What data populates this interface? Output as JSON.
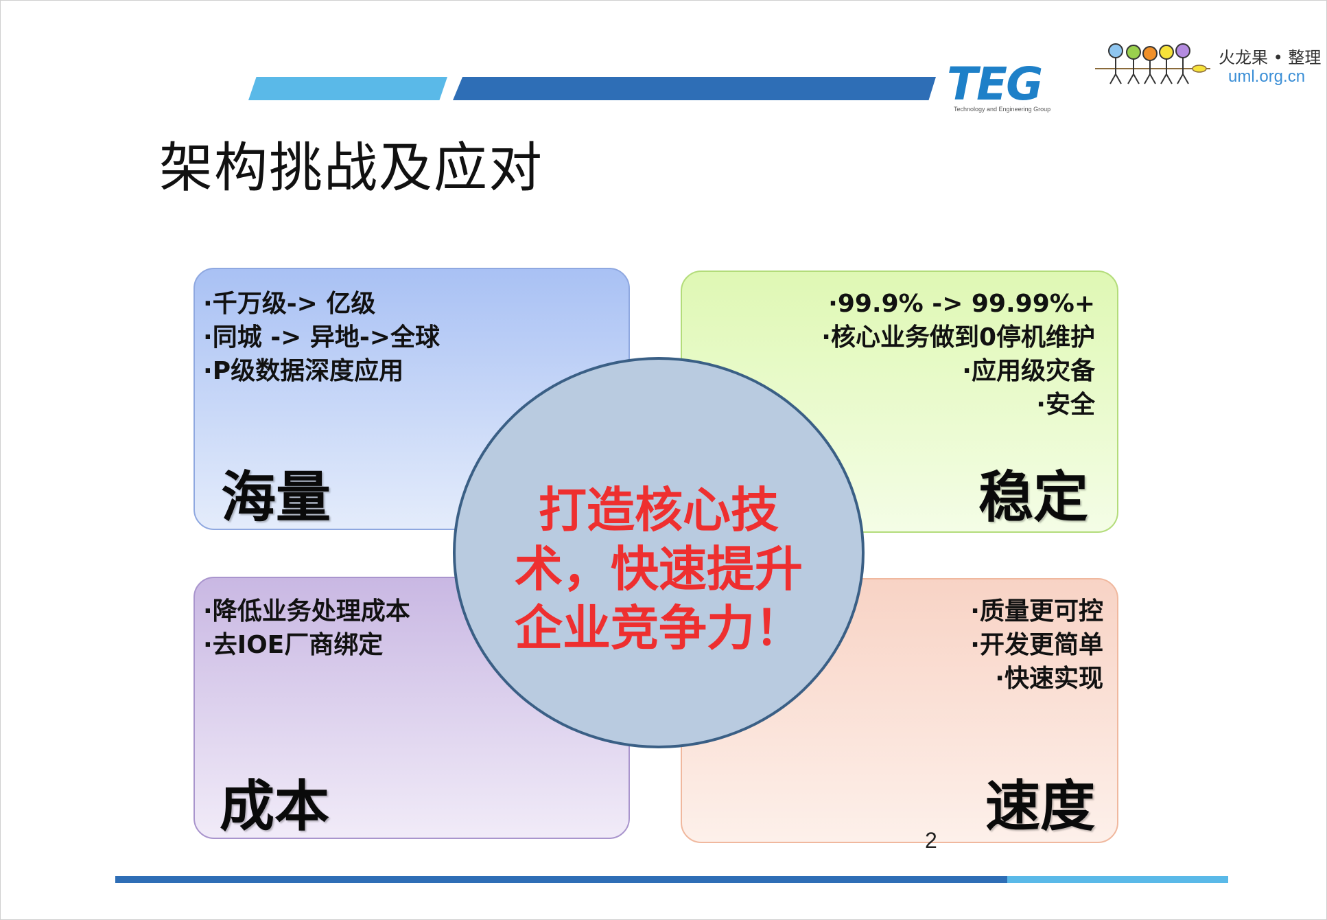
{
  "header": {
    "logo_text": "TEG",
    "logo_subtitle": "Technology and Engineering Group",
    "brand_name": "火龙果 • 整理",
    "brand_url": "uml.org.cn"
  },
  "title": "架构挑战及应对",
  "quadrants": {
    "top_left": {
      "label": "海量",
      "bullets": [
        "千万级-> 亿级",
        "同城 -> 异地->全球",
        "P级数据深度应用"
      ]
    },
    "top_right": {
      "label": "稳定",
      "bullets": [
        "99.9% -> 99.99%+",
        "核心业务做到0停机维护",
        "应用级灾备",
        "安全"
      ]
    },
    "bottom_left": {
      "label": "成本",
      "bullets": [
        "降低业务处理成本",
        "去IOE厂商绑定"
      ]
    },
    "bottom_right": {
      "label": "速度",
      "bullets": [
        "质量更可控",
        "开发更简单",
        "快速实现"
      ]
    }
  },
  "center": {
    "lines": [
      "打造核心技",
      "术，快速提升",
      "企业竞争力！"
    ]
  },
  "page_number": "2",
  "colors": {
    "accent_dark": "#2e6eb6",
    "accent_light": "#5ab9e8",
    "center_text": "#ee2f2f",
    "teg_blue": "#1e80c8"
  }
}
